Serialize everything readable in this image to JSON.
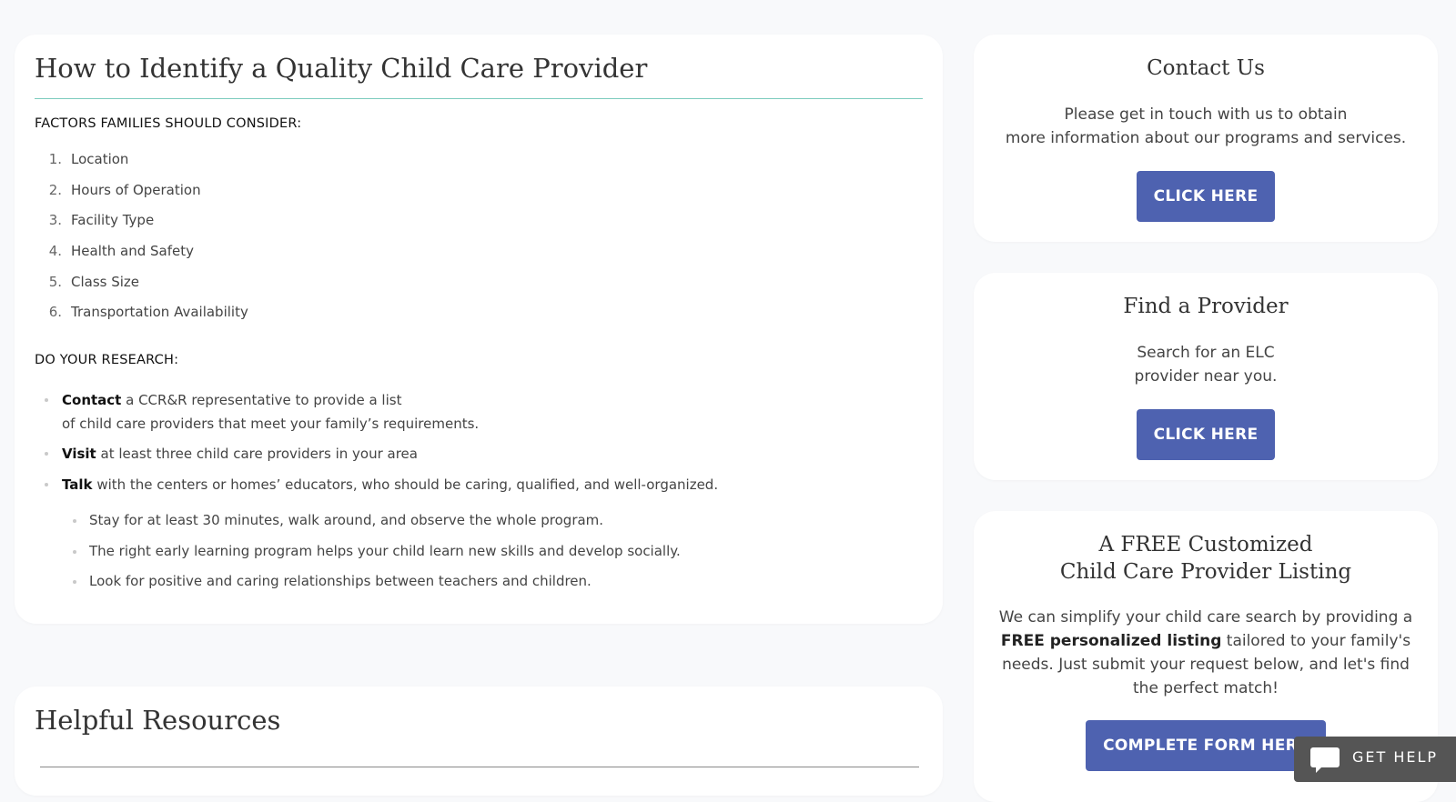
{
  "main": {
    "title": "How to Identify a Quality Child Care Provider",
    "factors_heading": "FACTORS FAMILIES SHOULD CONSIDER:",
    "factors": [
      {
        "num": "1.",
        "label": "Location"
      },
      {
        "num": "2.",
        "label": "Hours of Operation"
      },
      {
        "num": "3.",
        "label": "Facility Type"
      },
      {
        "num": "4.",
        "label": "Health and Safety"
      },
      {
        "num": "5.",
        "label": "Class Size"
      },
      {
        "num": "6.",
        "label": "Transportation Availability"
      }
    ],
    "research_heading": "DO YOUR RESEARCH:",
    "research": [
      {
        "bold": "Contact",
        "text_line1": " a CCR&R representative to provide a list",
        "text_line2": "of child care providers that meet your family’s requirements."
      },
      {
        "bold": "Visit",
        "text": " at least three child care providers in your area"
      },
      {
        "bold": "Talk",
        "text": " with the centers or homes’ educators, who should be caring, qualified, and well-organized."
      }
    ],
    "sub_items": [
      "Stay for at least 30 minutes, walk around, and observe the whole program.",
      "The right early learning program helps your child learn new skills and develop socially.",
      "Look for positive and caring relationships between teachers and children."
    ]
  },
  "resources": {
    "title": "Helpful Resources"
  },
  "contact": {
    "title": "Contact Us",
    "line1": "Please get in touch with us to obtain",
    "line2": "more information about our programs and services.",
    "button": "CLICK HERE"
  },
  "find": {
    "title": "Find a Provider",
    "line1": "Search for an ELC",
    "line2": "provider near you.",
    "button": "CLICK HERE"
  },
  "listing": {
    "title_line1": "A FREE Customized",
    "title_line2": "Child Care Provider Listing",
    "text_before": "We can simplify your child care search by providing a ",
    "text_bold": "FREE personalized listing",
    "text_after": " tailored to your family's needs. Just submit your request below, and let's find the perfect match!",
    "button": "COMPLETE FORM HERE"
  },
  "help_widget": {
    "label": "GET HELP",
    "icon": "chat-icon"
  },
  "colors": {
    "accent_button": "#4e62b0",
    "title_rule": "#7ccbbe",
    "background": "#f8f9fb"
  }
}
